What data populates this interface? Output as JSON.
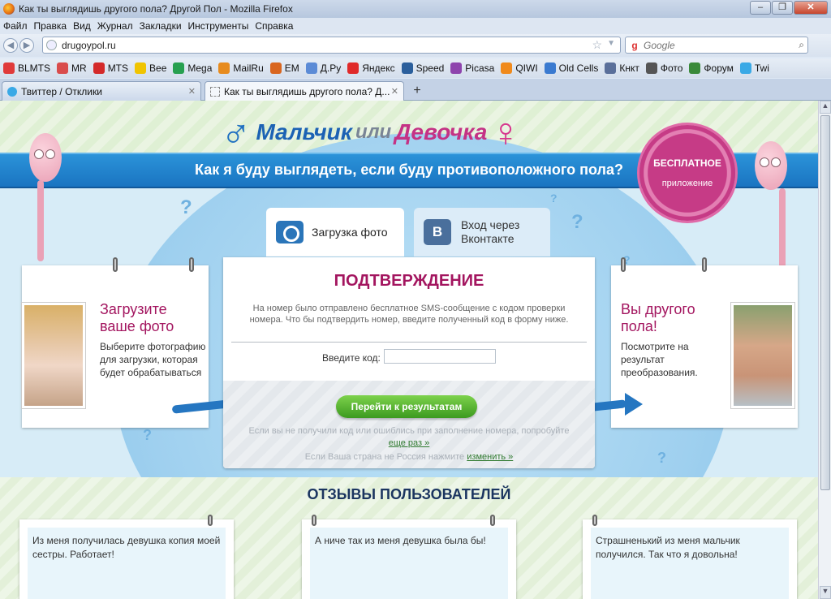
{
  "window": {
    "title": "Как ты выглядишь другого пола? Другой Пол - Mozilla Firefox",
    "controls": [
      "–",
      "❐",
      "✕"
    ]
  },
  "menu": [
    "Файл",
    "Правка",
    "Вид",
    "Журнал",
    "Закладки",
    "Инструменты",
    "Справка"
  ],
  "nav": {
    "url": "drugoypol.ru",
    "search_placeholder": "Google"
  },
  "bookmarks": [
    {
      "label": "BLMTS",
      "color": "#e03a3a"
    },
    {
      "label": "MR",
      "color": "#d94c4c"
    },
    {
      "label": "MTS",
      "color": "#d42a2a"
    },
    {
      "label": "Bee",
      "color": "#f0c400"
    },
    {
      "label": "Mega",
      "color": "#27a050"
    },
    {
      "label": "MailRu",
      "color": "#e78b1e"
    },
    {
      "label": "EM",
      "color": "#d9661f"
    },
    {
      "label": "Д.Ру",
      "color": "#5b8bd6"
    },
    {
      "label": "Яндекс",
      "color": "#e02a2a"
    },
    {
      "label": "Speed",
      "color": "#2b5f9c"
    },
    {
      "label": "Picasa",
      "color": "#8e44ad"
    },
    {
      "label": "QIWI",
      "color": "#f08a1c"
    },
    {
      "label": "Old Cells",
      "color": "#3a7ad0"
    },
    {
      "label": "Кнкт",
      "color": "#5a6f9a"
    },
    {
      "label": "Фото",
      "color": "#555555"
    },
    {
      "label": "Форум",
      "color": "#3a8a3a"
    },
    {
      "label": "Twi",
      "color": "#3aa9e6"
    }
  ],
  "tabs": [
    {
      "label": "Твиттер / Отклики"
    },
    {
      "label": "Как ты выглядишь другого пола? Д..."
    }
  ],
  "site": {
    "logo": {
      "w1": "Мальчик",
      "w2": "или",
      "w3": "Девочка"
    },
    "banner": "Как я буду выглядеть, если буду противоположного пола?",
    "badge": {
      "line1": "БЕСПЛАТНОЕ",
      "line2": "приложение"
    },
    "tab_upload": "Загрузка фото",
    "tab_vk": "Вход через Вконтакте",
    "confirm": {
      "heading": "ПОДТВЕРЖДЕНИЕ",
      "description": "На номер было отправлено бесплатное SMS-сообщение с кодом проверки номера. Что бы подтвердить номер, введите полученный код в форму ниже.",
      "code_label": "Введите код:",
      "code_value": "",
      "button": "Перейти к результатам",
      "retry_text": "Если вы не получили код или ошиблись при заполнение номера, попробуйте",
      "retry_link": "еще раз »",
      "country_text": "Если Ваша страна не Россия нажмите",
      "country_link": "изменить »"
    },
    "card_left": {
      "title": "Загрузите ваше фото",
      "body": "Выберите фотографию для загрузки, которая будет обрабатываться"
    },
    "card_right": {
      "title": "Вы другого пола!",
      "body": "Посмотрите на результат преобразования."
    },
    "reviews_title": "ОТЗЫВЫ ПОЛЬЗОВАТЕЛЕЙ",
    "reviews": [
      {
        "text": "Из меня получилась девушка копия моей сестры. Работает!"
      },
      {
        "text": "А ниче так из меня девушка была бы!"
      },
      {
        "text": "Страшненький из меня мальчик получился. Так что я довольна!"
      }
    ]
  }
}
